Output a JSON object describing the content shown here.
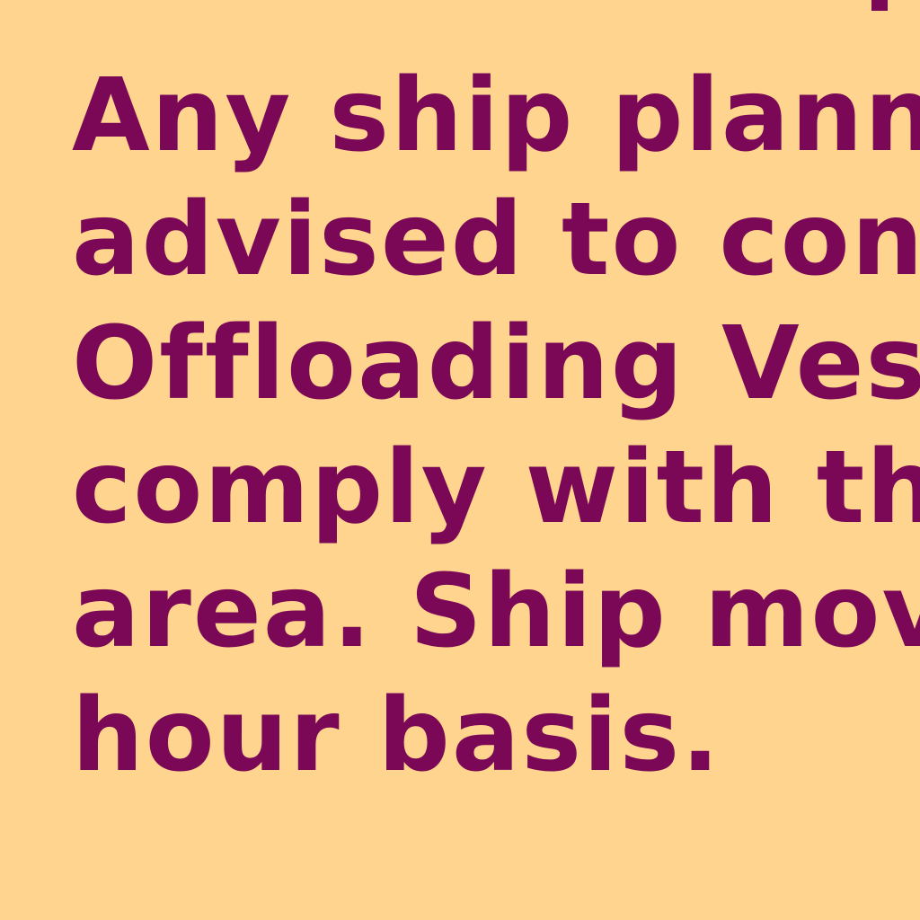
{
  "colors": {
    "background": "#FFD48E",
    "text": "#7A0856"
  },
  "notice": {
    "lines": [
      "Any ship plannin",
      "advised to conta",
      "Offloading Vess",
      "comply with the",
      "area. Ship move",
      "hour basis."
    ]
  }
}
